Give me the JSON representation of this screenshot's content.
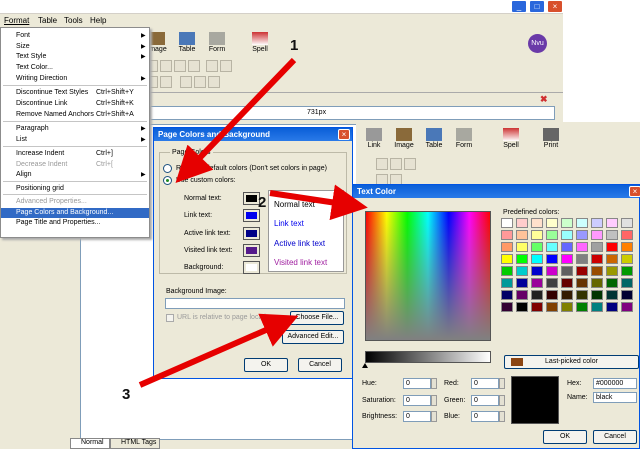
{
  "menubar": {
    "format": "Format",
    "table": "Table",
    "tools": "Tools",
    "help": "Help"
  },
  "toolbar_top": {
    "image": "Image",
    "table": "Table",
    "form": "Form",
    "spell": "Spell"
  },
  "ruler": {
    "width_label": "731px"
  },
  "format_menu": {
    "items": [
      {
        "label": "Font",
        "shortcut": "",
        "arrow": "▶",
        "disabled": false
      },
      {
        "label": "Size",
        "shortcut": "",
        "arrow": "▶",
        "disabled": false
      },
      {
        "label": "Text Style",
        "shortcut": "",
        "arrow": "▶",
        "disabled": false
      },
      {
        "label": "Text Color...",
        "shortcut": "",
        "arrow": "",
        "disabled": false
      },
      {
        "label": "Writing Direction",
        "shortcut": "",
        "arrow": "▶",
        "disabled": false
      },
      {
        "label": "Discontinue Text Styles",
        "shortcut": "Ctrl+Shift+Y",
        "arrow": "",
        "disabled": false
      },
      {
        "label": "Discontinue Link",
        "shortcut": "Ctrl+Shift+K",
        "arrow": "",
        "disabled": false
      },
      {
        "label": "Remove Named Anchors",
        "shortcut": "Ctrl+Shift+A",
        "arrow": "",
        "disabled": false
      },
      {
        "label": "Paragraph",
        "shortcut": "",
        "arrow": "▶",
        "disabled": false
      },
      {
        "label": "List",
        "shortcut": "",
        "arrow": "▶",
        "disabled": false
      },
      {
        "label": "Increase Indent",
        "shortcut": "Ctrl+]",
        "arrow": "",
        "disabled": false
      },
      {
        "label": "Decrease Indent",
        "shortcut": "Ctrl+[",
        "arrow": "",
        "disabled": true
      },
      {
        "label": "Align",
        "shortcut": "",
        "arrow": "▶",
        "disabled": false
      },
      {
        "label": "Positioning grid",
        "shortcut": "",
        "arrow": "",
        "disabled": false
      },
      {
        "label": "Advanced Properties...",
        "shortcut": "",
        "arrow": "",
        "disabled": true
      },
      {
        "label": "Page Colors and Background...",
        "shortcut": "",
        "arrow": "",
        "disabled": false
      },
      {
        "label": "Page Title and Properties...",
        "shortcut": "",
        "arrow": "",
        "disabled": false
      }
    ]
  },
  "page_colors_dialog": {
    "title": "Page Colors and Background",
    "group_label": "Page Colors",
    "reader_default": "Reader's default colors (Don't set colors in page)",
    "use_custom": "Use custom colors:",
    "normal_text": "Normal text:",
    "link_text": "Link text:",
    "active_link_text": "Active link text:",
    "visited_link_text": "Visited link text:",
    "background": "Background:",
    "preview_normal": "Normal text",
    "preview_link": "Link text",
    "preview_active": "Active link text",
    "preview_visited": "Visited link text",
    "background_image": "Background Image:",
    "url_relative": "URL is relative to page location",
    "choose_file": "Choose File...",
    "advanced_edit": "Advanced Edit...",
    "ok": "OK",
    "cancel": "Cancel",
    "colors": {
      "normal": "#000000",
      "link": "#0000ee",
      "active": "#000088",
      "visited": "#551a8b",
      "background": "#ffffff"
    }
  },
  "toolbar_second": {
    "link": "Link",
    "image": "Image",
    "table": "Table",
    "form": "Form",
    "spell": "Spell",
    "print": "Print"
  },
  "text_color_dialog": {
    "title": "Text Color",
    "predefined": "Predefined colors:",
    "last_picked": "Last-picked color",
    "hue": "Hue:",
    "saturation": "Saturation:",
    "brightness": "Brightness:",
    "red": "Red:",
    "green": "Green:",
    "blue": "Blue:",
    "hue_val": "0",
    "sat_val": "0",
    "bri_val": "0",
    "red_val": "0",
    "green_val": "0",
    "blue_val": "0",
    "hex": "Hex:",
    "hex_val": "#000000",
    "name": "Name:",
    "name_val": "black",
    "ok": "OK",
    "cancel": "Cancel",
    "last_color": "#8b4513"
  },
  "tabs": {
    "normal": "Normal",
    "html_tags": "HTML Tags"
  },
  "annotations": {
    "one": "1",
    "two": "2",
    "three": "3"
  }
}
